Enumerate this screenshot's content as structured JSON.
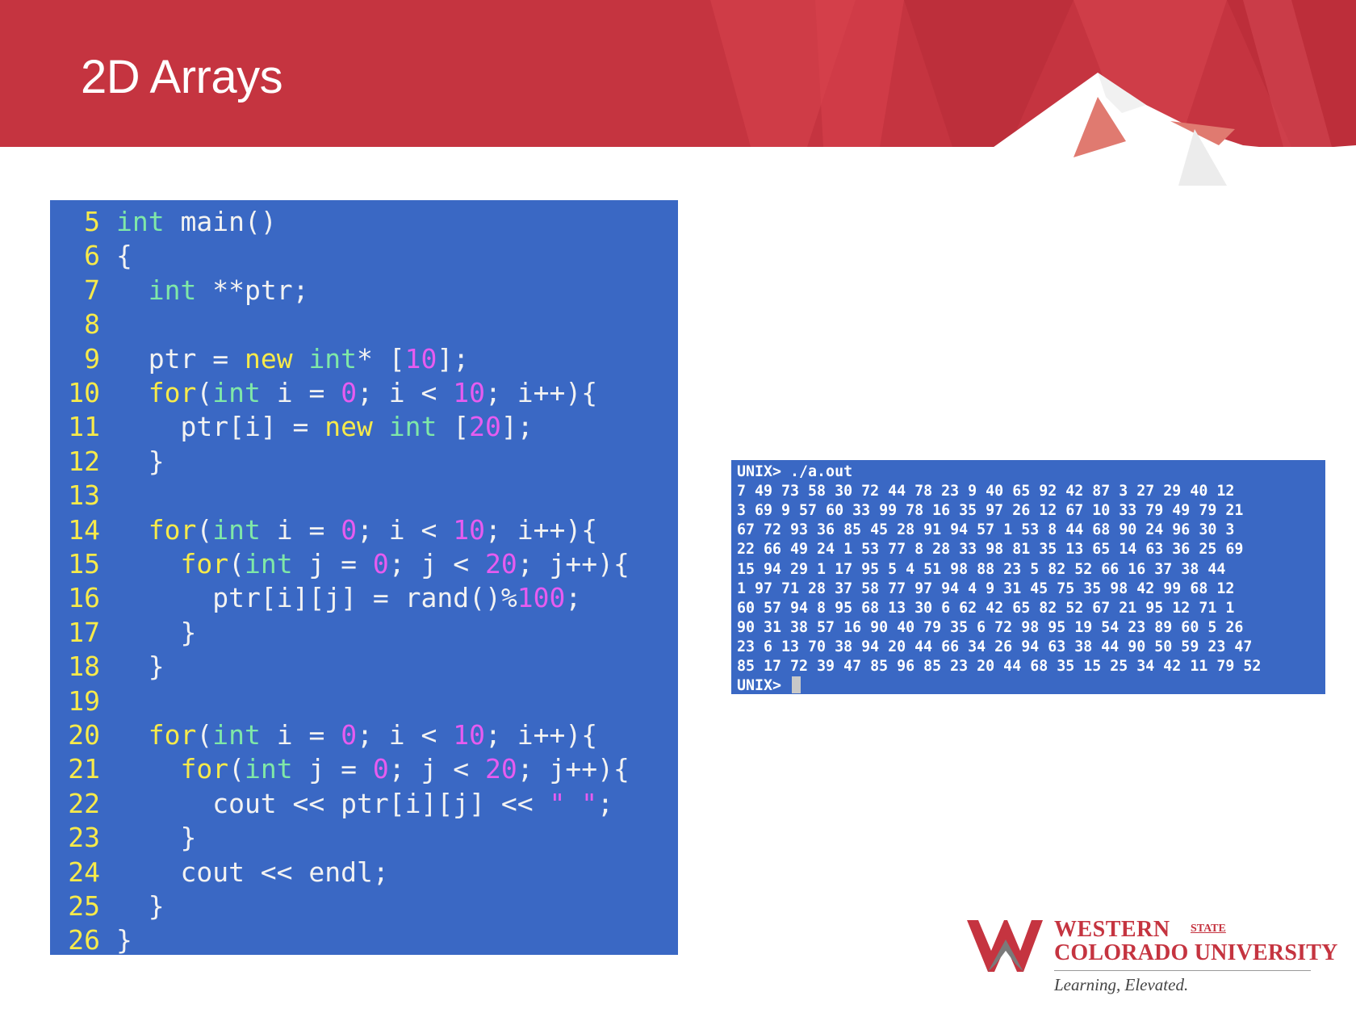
{
  "slide": {
    "title": "2D Arrays"
  },
  "colors": {
    "header_red": "#c53440",
    "panel_blue": "#3a68c4",
    "line_number_yellow": "#f7ea4a",
    "keyword_yellow": "#f7ea4a",
    "type_green": "#7fe8a8",
    "number_magenta": "#e65cf0",
    "plain_text": "#f2f2f2"
  },
  "code": {
    "lines": [
      {
        "num": "5",
        "tokens": [
          {
            "t": "type",
            "v": "int"
          },
          {
            "t": "plain",
            "v": " main()"
          }
        ]
      },
      {
        "num": "6",
        "tokens": [
          {
            "t": "plain",
            "v": "{"
          }
        ]
      },
      {
        "num": "7",
        "tokens": [
          {
            "t": "plain",
            "v": "  "
          },
          {
            "t": "type",
            "v": "int"
          },
          {
            "t": "plain",
            "v": " **ptr;"
          }
        ]
      },
      {
        "num": "8",
        "tokens": []
      },
      {
        "num": "9",
        "tokens": [
          {
            "t": "plain",
            "v": "  ptr = "
          },
          {
            "t": "kw",
            "v": "new"
          },
          {
            "t": "plain",
            "v": " "
          },
          {
            "t": "type",
            "v": "int"
          },
          {
            "t": "plain",
            "v": "* ["
          },
          {
            "t": "num",
            "v": "10"
          },
          {
            "t": "plain",
            "v": "];"
          }
        ]
      },
      {
        "num": "10",
        "tokens": [
          {
            "t": "plain",
            "v": "  "
          },
          {
            "t": "kw",
            "v": "for"
          },
          {
            "t": "plain",
            "v": "("
          },
          {
            "t": "type",
            "v": "int"
          },
          {
            "t": "plain",
            "v": " i = "
          },
          {
            "t": "num",
            "v": "0"
          },
          {
            "t": "plain",
            "v": "; i < "
          },
          {
            "t": "num",
            "v": "10"
          },
          {
            "t": "plain",
            "v": "; i++){"
          }
        ]
      },
      {
        "num": "11",
        "tokens": [
          {
            "t": "plain",
            "v": "    ptr[i] = "
          },
          {
            "t": "kw",
            "v": "new"
          },
          {
            "t": "plain",
            "v": " "
          },
          {
            "t": "type",
            "v": "int"
          },
          {
            "t": "plain",
            "v": " ["
          },
          {
            "t": "num",
            "v": "20"
          },
          {
            "t": "plain",
            "v": "];"
          }
        ]
      },
      {
        "num": "12",
        "tokens": [
          {
            "t": "plain",
            "v": "  }"
          }
        ]
      },
      {
        "num": "13",
        "tokens": []
      },
      {
        "num": "14",
        "tokens": [
          {
            "t": "plain",
            "v": "  "
          },
          {
            "t": "kw",
            "v": "for"
          },
          {
            "t": "plain",
            "v": "("
          },
          {
            "t": "type",
            "v": "int"
          },
          {
            "t": "plain",
            "v": " i = "
          },
          {
            "t": "num",
            "v": "0"
          },
          {
            "t": "plain",
            "v": "; i < "
          },
          {
            "t": "num",
            "v": "10"
          },
          {
            "t": "plain",
            "v": "; i++){"
          }
        ]
      },
      {
        "num": "15",
        "tokens": [
          {
            "t": "plain",
            "v": "    "
          },
          {
            "t": "kw",
            "v": "for"
          },
          {
            "t": "plain",
            "v": "("
          },
          {
            "t": "type",
            "v": "int"
          },
          {
            "t": "plain",
            "v": " j = "
          },
          {
            "t": "num",
            "v": "0"
          },
          {
            "t": "plain",
            "v": "; j < "
          },
          {
            "t": "num",
            "v": "20"
          },
          {
            "t": "plain",
            "v": "; j++){"
          }
        ]
      },
      {
        "num": "16",
        "tokens": [
          {
            "t": "plain",
            "v": "      ptr[i][j] = rand()%"
          },
          {
            "t": "num",
            "v": "100"
          },
          {
            "t": "plain",
            "v": ";"
          }
        ]
      },
      {
        "num": "17",
        "tokens": [
          {
            "t": "plain",
            "v": "    }"
          }
        ]
      },
      {
        "num": "18",
        "tokens": [
          {
            "t": "plain",
            "v": "  }"
          }
        ]
      },
      {
        "num": "19",
        "tokens": []
      },
      {
        "num": "20",
        "tokens": [
          {
            "t": "plain",
            "v": "  "
          },
          {
            "t": "kw",
            "v": "for"
          },
          {
            "t": "plain",
            "v": "("
          },
          {
            "t": "type",
            "v": "int"
          },
          {
            "t": "plain",
            "v": " i = "
          },
          {
            "t": "num",
            "v": "0"
          },
          {
            "t": "plain",
            "v": "; i < "
          },
          {
            "t": "num",
            "v": "10"
          },
          {
            "t": "plain",
            "v": "; i++){"
          }
        ]
      },
      {
        "num": "21",
        "tokens": [
          {
            "t": "plain",
            "v": "    "
          },
          {
            "t": "kw",
            "v": "for"
          },
          {
            "t": "plain",
            "v": "("
          },
          {
            "t": "type",
            "v": "int"
          },
          {
            "t": "plain",
            "v": " j = "
          },
          {
            "t": "num",
            "v": "0"
          },
          {
            "t": "plain",
            "v": "; j < "
          },
          {
            "t": "num",
            "v": "20"
          },
          {
            "t": "plain",
            "v": "; j++){"
          }
        ]
      },
      {
        "num": "22",
        "tokens": [
          {
            "t": "plain",
            "v": "      cout << ptr[i][j] << "
          },
          {
            "t": "str",
            "v": "\" \""
          },
          {
            "t": "plain",
            "v": ";"
          }
        ]
      },
      {
        "num": "23",
        "tokens": [
          {
            "t": "plain",
            "v": "    }"
          }
        ]
      },
      {
        "num": "24",
        "tokens": [
          {
            "t": "plain",
            "v": "    cout << endl;"
          }
        ]
      },
      {
        "num": "25",
        "tokens": [
          {
            "t": "plain",
            "v": "  }"
          }
        ]
      },
      {
        "num": "26",
        "tokens": [
          {
            "t": "plain",
            "v": "}"
          }
        ]
      }
    ]
  },
  "terminal": {
    "command_line": "UNIX> ./a.out",
    "output_lines": [
      "7 49 73 58 30 72 44 78 23 9 40 65 92 42 87 3 27 29 40 12",
      "3 69 9 57 60 33 99 78 16 35 97 26 12 67 10 33 79 49 79 21",
      "67 72 93 36 85 45 28 91 94 57 1 53 8 44 68 90 24 96 30 3",
      "22 66 49 24 1 53 77 8 28 33 98 81 35 13 65 14 63 36 25 69",
      "15 94 29 1 17 95 5 4 51 98 88 23 5 82 52 66 16 37 38 44",
      "1 97 71 28 37 58 77 97 94 4 9 31 45 75 35 98 42 99 68 12",
      "60 57 94 8 95 68 13 30 6 62 42 65 82 52 67 21 95 12 71 1",
      "90 31 38 57 16 90 40 79 35 6 72 98 95 19 54 23 89 60 5 26",
      "23 6 13 70 38 94 20 44 66 34 26 94 63 38 44 90 50 59 23 47",
      "85 17 72 39 47 85 96 85 23 20 44 68 35 15 25 34 42 11 79 52"
    ],
    "prompt": "UNIX> "
  },
  "logo": {
    "name_line1": "WESTERN",
    "name_state": "STATE",
    "name_line2": "COLORADO UNIVERSITY",
    "tagline": "Learning, Elevated."
  }
}
